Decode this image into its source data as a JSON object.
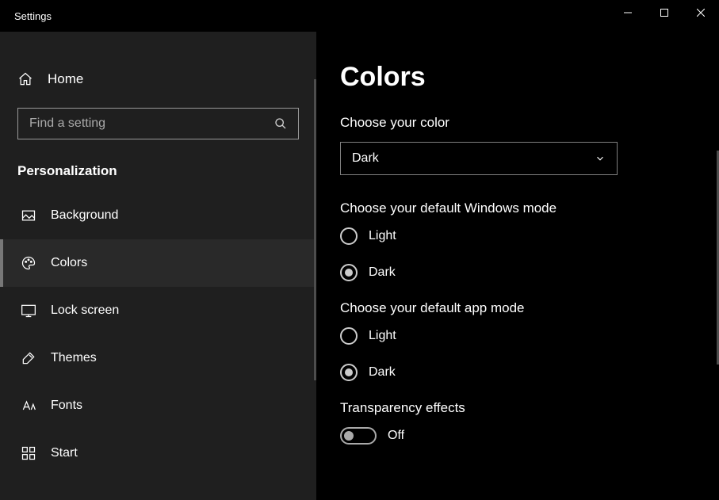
{
  "titlebar": {
    "title": "Settings"
  },
  "sidebar": {
    "home": "Home",
    "search_placeholder": "Find a setting",
    "category": "Personalization",
    "items": [
      {
        "label": "Background"
      },
      {
        "label": "Colors"
      },
      {
        "label": "Lock screen"
      },
      {
        "label": "Themes"
      },
      {
        "label": "Fonts"
      },
      {
        "label": "Start"
      }
    ]
  },
  "main": {
    "title": "Colors",
    "choose_color_label": "Choose your color",
    "choose_color_value": "Dark",
    "windows_mode_label": "Choose your default Windows mode",
    "windows_mode_options": {
      "light": "Light",
      "dark": "Dark"
    },
    "app_mode_label": "Choose your default app mode",
    "app_mode_options": {
      "light": "Light",
      "dark": "Dark"
    },
    "transparency_label": "Transparency effects",
    "transparency_value": "Off"
  }
}
